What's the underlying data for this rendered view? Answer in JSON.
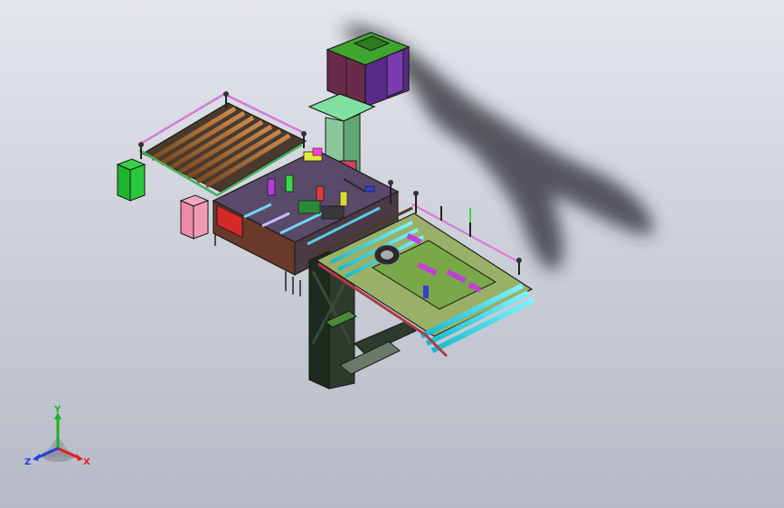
{
  "colors": {
    "axis_x": "#e02020",
    "axis_y": "#20b020",
    "axis_z": "#2040e0"
  },
  "triad": {
    "x_label": "X",
    "y_label": "Y",
    "z_label": "Z"
  }
}
